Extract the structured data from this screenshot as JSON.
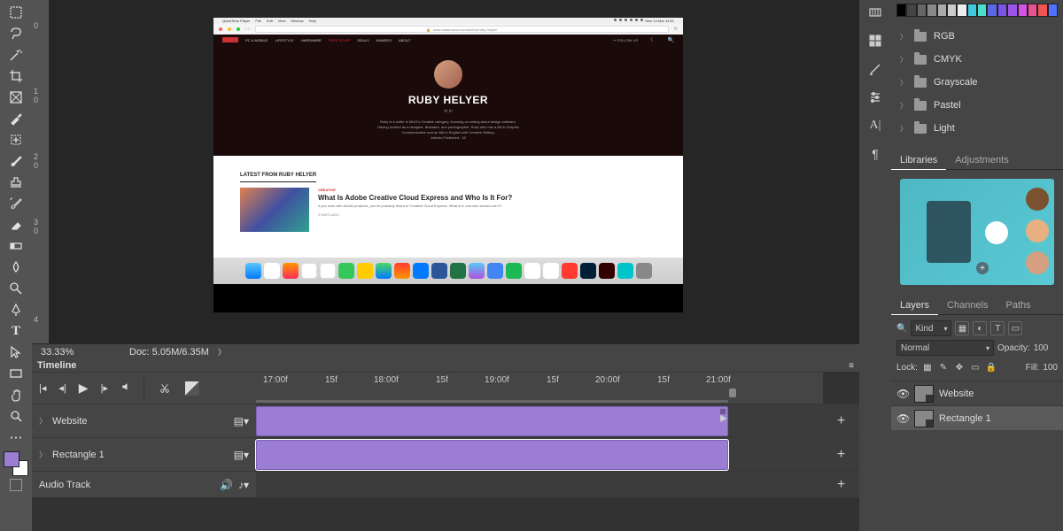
{
  "status": {
    "zoom": "33.33%",
    "doc": "Doc: 5.05M/6.35M"
  },
  "timeline": {
    "title": "Timeline",
    "ruler": [
      "17:00f",
      "15f",
      "18:00f",
      "15f",
      "19:00f",
      "15f",
      "20:00f",
      "15f",
      "21:00f"
    ],
    "tracks": [
      {
        "name": "Website"
      },
      {
        "name": "Rectangle 1"
      }
    ],
    "audio": "Audio Track"
  },
  "swatches": {
    "colors": [
      "#000",
      "#444",
      "#666",
      "#888",
      "#aaa",
      "#ccc",
      "#eee",
      "#40c8e0",
      "#48e0c8",
      "#5a68e4",
      "#7a54e8",
      "#9b54e8",
      "#d454e8",
      "#e85490",
      "#f05454",
      "#5070ff"
    ],
    "groups": [
      "RGB",
      "CMYK",
      "Grayscale",
      "Pastel",
      "Light"
    ]
  },
  "panel_tabs": {
    "libraries": "Libraries",
    "adjustments": "Adjustments"
  },
  "layers_panel": {
    "tabs": [
      "Layers",
      "Channels",
      "Paths"
    ],
    "kind": "Kind",
    "blend": "Normal",
    "opacity_label": "Opacity:",
    "opacity_val": "100",
    "lock_label": "Lock:",
    "fill_label": "Fill:",
    "fill_val": "100",
    "layers": [
      {
        "name": "Website"
      },
      {
        "name": "Rectangle 1"
      }
    ]
  },
  "doc_content": {
    "qt": "QuickTime Player",
    "menus": [
      "File",
      "Edit",
      "View",
      "Window",
      "Help"
    ],
    "clock": "Mon 14 Mar 14:51",
    "url": "www.makeuseof.com/author/ruby-helyer/",
    "nav": [
      "PC & MOBILE",
      "LIFESTYLE",
      "HARDWARE",
      "FREE STUFF",
      "DEALS",
      "AWARDS",
      "ABOUT"
    ],
    "follow": "FOLLOW US",
    "name": "RUBY HELYER",
    "bio1": "Ruby is a writer in MUO's Creative category, focusing on writing about design software.",
    "bio2": "Having worked as a designer, illustrator, and photographer, Ruby also has a BA in Graphic",
    "bio3": "Communication and an MA in English with Creative Writing.",
    "bio4": "Articles Published : 15",
    "section": "LATEST FROM RUBY HELYER",
    "cat": "CREATIVE",
    "article_title": "What Is Adobe Creative Cloud Express and Who Is It For?",
    "article_desc": "If you work with Adobe products, you've probably heard of Creative Cloud Express. What is it, and who should use it?",
    "article_date": "2 DAYS AGO"
  }
}
